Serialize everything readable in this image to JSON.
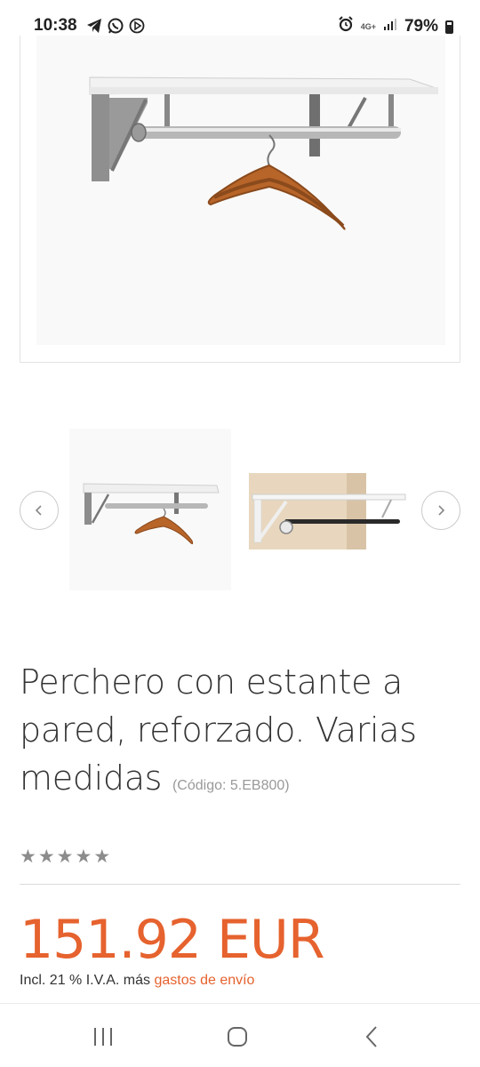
{
  "status_bar": {
    "time": "10:38",
    "network": "4G+",
    "battery": "79%"
  },
  "carousel": {
    "prev_icon": "chevron-left-icon",
    "next_icon": "chevron-right-icon"
  },
  "product": {
    "title": "Perchero con estante a pared, reforzado. Varias medidas",
    "code": "(Código: 5.EB800)",
    "rating_stars": 5,
    "rating_filled": 0,
    "price": "151.92 EUR",
    "tax_text": "Incl. 21 % I.V.A. más ",
    "shipping_link": "gastos de envío"
  },
  "colors": {
    "accent": "#e6622e",
    "star": "#8c8c8c"
  }
}
